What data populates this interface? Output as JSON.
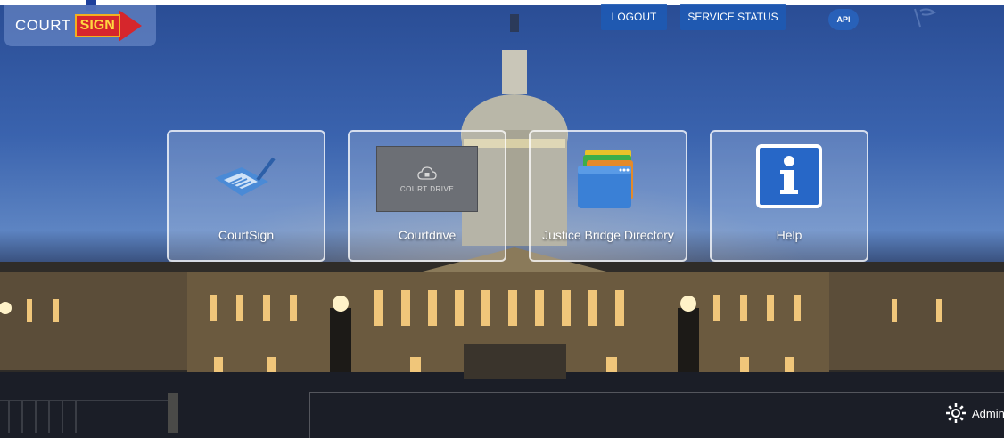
{
  "logo": {
    "court": "COURT",
    "sign": "SIGN"
  },
  "topnav": {
    "logout": "LOGOUT",
    "service_status": "SERVICE STATUS",
    "api": "API"
  },
  "tiles": [
    {
      "label": "CourtSign",
      "icon": "courtsign-pen-icon"
    },
    {
      "label": "Courtdrive",
      "icon": "court-drive-icon",
      "icon_caption": "COURT DRIVE"
    },
    {
      "label": "Justice Bridge Directory",
      "icon": "folder-stack-icon"
    },
    {
      "label": "Help",
      "icon": "info-icon"
    }
  ],
  "footer": {
    "admin_label": "Admin",
    "icon": "gear-icon"
  },
  "colors": {
    "button_blue": "#1e5ab4",
    "sign_red": "#d6262c",
    "sign_yellow": "#ffd740"
  }
}
